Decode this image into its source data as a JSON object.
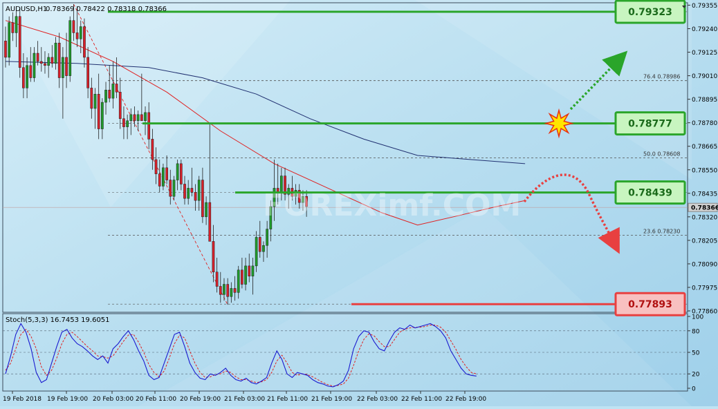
{
  "header": {
    "symbol": "AUDUSD,H1",
    "ohlc": "0.78369 0.78422 0.78318 0.78366",
    "stoch_label": "Stoch(5,3,3) 16.7453 19.6051"
  },
  "watermark": "FOREXimf.COM",
  "colors": {
    "background": "#bfe3f3",
    "bull_candle": "#1f9a2a",
    "bear_candle": "#d8202a",
    "ma_fast": "#e02020",
    "ma_slow": "#203070",
    "support_resistance": "#2aa52a",
    "box_green_fill": "#c8f5c0",
    "box_red_fill": "#f8c0c0",
    "stoch_main": "#1a1ad0",
    "stoch_signal": "#e02020"
  },
  "chart_data": [
    {
      "type": "candlestick",
      "title": "AUDUSD,H1",
      "ylim": [
        0.7786,
        0.7936
      ],
      "y_ticks": [
        "0.79355",
        "0.79240",
        "0.79125",
        "0.79010",
        "0.78895",
        "0.78780",
        "0.78665",
        "0.78550",
        "0.78435",
        "0.78366",
        "0.78320",
        "0.78205",
        "0.78090",
        "0.77975",
        "0.77860"
      ],
      "current_price": "0.78366",
      "x_ticks": [
        "19 Feb 2018",
        "19 Feb 19:00",
        "20 Feb 03:00",
        "20 Feb 11:00",
        "20 Feb 19:00",
        "21 Feb 03:00",
        "21 Feb 11:00",
        "21 Feb 19:00",
        "22 Feb 03:00",
        "22 Feb 11:00",
        "22 Feb 19:00"
      ],
      "price_boxes": [
        {
          "label": "0.79323",
          "value": 0.79323,
          "color": "green"
        },
        {
          "label": "0.78777",
          "value": 0.78777,
          "color": "green"
        },
        {
          "label": "0.78439",
          "value": 0.78439,
          "color": "green"
        },
        {
          "label": "0.77893",
          "value": 0.77893,
          "color": "red"
        }
      ],
      "fibonacci": [
        {
          "label": "76.4",
          "price_label": "0.78986",
          "value": 0.78986
        },
        {
          "label": "50.0",
          "price_label": "0.78608",
          "value": 0.78608
        },
        {
          "label": "23.6",
          "price_label": "0.78230",
          "value": 0.7823
        }
      ],
      "candles": [
        [
          0.7918,
          0.7925,
          0.7905,
          0.791
        ],
        [
          0.791,
          0.793,
          0.7906,
          0.7927
        ],
        [
          0.7927,
          0.7932,
          0.7918,
          0.7922
        ],
        [
          0.7922,
          0.7933,
          0.7915,
          0.793
        ],
        [
          0.793,
          0.7934,
          0.79,
          0.7905
        ],
        [
          0.7905,
          0.7912,
          0.789,
          0.7895
        ],
        [
          0.7895,
          0.791,
          0.789,
          0.7906
        ],
        [
          0.7906,
          0.7915,
          0.7898,
          0.79
        ],
        [
          0.79,
          0.7915,
          0.7898,
          0.7912
        ],
        [
          0.7912,
          0.7918,
          0.7906,
          0.7908
        ],
        [
          0.7908,
          0.7915,
          0.7903,
          0.7907
        ],
        [
          0.7907,
          0.7913,
          0.7902,
          0.7906
        ],
        [
          0.7906,
          0.7912,
          0.79,
          0.791
        ],
        [
          0.791,
          0.7916,
          0.7905,
          0.7907
        ],
        [
          0.7907,
          0.792,
          0.7904,
          0.7917
        ],
        [
          0.7917,
          0.7922,
          0.7895,
          0.79
        ],
        [
          0.79,
          0.7915,
          0.788,
          0.791
        ],
        [
          0.791,
          0.7922,
          0.7895,
          0.7901
        ],
        [
          0.7901,
          0.793,
          0.7898,
          0.7928
        ],
        [
          0.7928,
          0.7936,
          0.7918,
          0.7922
        ],
        [
          0.7922,
          0.7935,
          0.7915,
          0.7919
        ],
        [
          0.7919,
          0.7928,
          0.7912,
          0.7925
        ],
        [
          0.7925,
          0.7929,
          0.7905,
          0.791
        ],
        [
          0.791,
          0.7915,
          0.789,
          0.7895
        ],
        [
          0.7895,
          0.79,
          0.788,
          0.7885
        ],
        [
          0.7885,
          0.7895,
          0.7875,
          0.7892
        ],
        [
          0.7892,
          0.7902,
          0.787,
          0.7875
        ],
        [
          0.7875,
          0.789,
          0.787,
          0.7888
        ],
        [
          0.7888,
          0.7898,
          0.7882,
          0.7894
        ],
        [
          0.7894,
          0.7906,
          0.7888,
          0.789
        ],
        [
          0.789,
          0.7908,
          0.7885,
          0.7897
        ],
        [
          0.7897,
          0.791,
          0.789,
          0.7893
        ],
        [
          0.7893,
          0.79,
          0.7875,
          0.788
        ],
        [
          0.788,
          0.7886,
          0.787,
          0.7876
        ],
        [
          0.7876,
          0.7882,
          0.787,
          0.7879
        ],
        [
          0.7879,
          0.7885,
          0.7872,
          0.7882
        ],
        [
          0.7882,
          0.7886,
          0.7876,
          0.7879
        ],
        [
          0.7879,
          0.7884,
          0.7874,
          0.7882
        ],
        [
          0.7882,
          0.7902,
          0.788,
          0.7879
        ],
        [
          0.7879,
          0.7886,
          0.7872,
          0.7883
        ],
        [
          0.7883,
          0.7888,
          0.7865,
          0.787
        ],
        [
          0.787,
          0.7875,
          0.7855,
          0.786
        ],
        [
          0.786,
          0.7866,
          0.7848,
          0.7853
        ],
        [
          0.7853,
          0.786,
          0.7844,
          0.7847
        ],
        [
          0.7847,
          0.7858,
          0.7845,
          0.7856
        ],
        [
          0.7856,
          0.7862,
          0.7848,
          0.785
        ],
        [
          0.785,
          0.7855,
          0.7838,
          0.7842
        ],
        [
          0.7842,
          0.7852,
          0.784,
          0.785
        ],
        [
          0.785,
          0.786,
          0.7845,
          0.7858
        ],
        [
          0.7858,
          0.786,
          0.7845,
          0.7848
        ],
        [
          0.7848,
          0.7852,
          0.7838,
          0.7841
        ],
        [
          0.7841,
          0.785,
          0.7838,
          0.7846
        ],
        [
          0.7846,
          0.7856,
          0.7842,
          0.7844
        ],
        [
          0.7844,
          0.7848,
          0.7835,
          0.784
        ],
        [
          0.784,
          0.7852,
          0.7835,
          0.785
        ],
        [
          0.785,
          0.7856,
          0.7829,
          0.7832
        ],
        [
          0.7832,
          0.7842,
          0.7828,
          0.7839
        ],
        [
          0.7839,
          0.7878,
          0.7826,
          0.782
        ],
        [
          0.782,
          0.7828,
          0.78,
          0.7805
        ],
        [
          0.7805,
          0.7812,
          0.7795,
          0.7798
        ],
        [
          0.7798,
          0.7805,
          0.779,
          0.7794
        ],
        [
          0.7794,
          0.7802,
          0.7791,
          0.7799
        ],
        [
          0.7799,
          0.7802,
          0.7789,
          0.7793
        ],
        [
          0.7793,
          0.78,
          0.779,
          0.7797
        ],
        [
          0.7797,
          0.7803,
          0.7791,
          0.7795
        ],
        [
          0.7795,
          0.7808,
          0.7792,
          0.7806
        ],
        [
          0.7806,
          0.7812,
          0.7797,
          0.7799
        ],
        [
          0.7799,
          0.7812,
          0.7796,
          0.7808
        ],
        [
          0.7808,
          0.7814,
          0.78,
          0.7803
        ],
        [
          0.7803,
          0.7812,
          0.7794,
          0.7808
        ],
        [
          0.7808,
          0.7825,
          0.7805,
          0.7822
        ],
        [
          0.7822,
          0.783,
          0.7812,
          0.7815
        ],
        [
          0.7815,
          0.782,
          0.781,
          0.7818
        ],
        [
          0.7818,
          0.783,
          0.7812,
          0.7826
        ],
        [
          0.7826,
          0.784,
          0.782,
          0.7837
        ],
        [
          0.7837,
          0.786,
          0.783,
          0.7846
        ],
        [
          0.7846,
          0.7858,
          0.7838,
          0.7844
        ],
        [
          0.7844,
          0.7856,
          0.784,
          0.7852
        ],
        [
          0.7852,
          0.7856,
          0.784,
          0.7843
        ],
        [
          0.7843,
          0.7848,
          0.7836,
          0.7846
        ],
        [
          0.7846,
          0.7852,
          0.784,
          0.7842
        ],
        [
          0.7842,
          0.7848,
          0.7838,
          0.7845
        ],
        [
          0.7845,
          0.7848,
          0.7836,
          0.7839
        ],
        [
          0.7839,
          0.7845,
          0.7835,
          0.7842
        ],
        [
          0.7842,
          0.7845,
          0.7832,
          0.7837
        ]
      ],
      "ma_fast": [
        [
          0,
          0.7928
        ],
        [
          15,
          0.792
        ],
        [
          30,
          0.7908
        ],
        [
          45,
          0.7893
        ],
        [
          60,
          0.7874
        ],
        [
          75,
          0.7858
        ],
        [
          90,
          0.7846
        ],
        [
          105,
          0.7834
        ],
        [
          115,
          0.7828
        ],
        [
          125,
          0.7832
        ],
        [
          137,
          0.7837
        ],
        [
          145,
          0.784
        ]
      ],
      "ma_slow": [
        [
          0,
          0.7908
        ],
        [
          20,
          0.7907
        ],
        [
          40,
          0.7905
        ],
        [
          55,
          0.79
        ],
        [
          70,
          0.7892
        ],
        [
          85,
          0.788
        ],
        [
          100,
          0.787
        ],
        [
          115,
          0.7862
        ],
        [
          130,
          0.786
        ],
        [
          145,
          0.7858
        ]
      ]
    },
    {
      "type": "line",
      "title": "Stoch(5,3,3) 16.7453 19.6051",
      "ylim": [
        0,
        100
      ],
      "y_ticks": [
        "100",
        "80",
        "50",
        "20",
        "0"
      ],
      "series": [
        {
          "values": [
            20,
            45,
            75,
            90,
            78,
            55,
            22,
            8,
            12,
            35,
            58,
            78,
            82,
            70,
            62,
            58,
            52,
            45,
            40,
            45,
            35,
            55,
            62,
            72,
            80,
            68,
            52,
            38,
            18,
            12,
            15,
            35,
            55,
            75,
            78,
            58,
            35,
            22,
            14,
            12,
            20,
            18,
            22,
            28,
            18,
            12,
            10,
            14,
            8,
            6,
            10,
            15,
            35,
            52,
            40,
            20,
            15,
            22,
            20,
            18,
            12,
            8,
            6,
            3,
            2,
            5,
            10,
            25,
            55,
            72,
            80,
            78,
            65,
            55,
            52,
            66,
            78,
            84,
            82,
            88,
            84,
            86,
            88,
            90,
            86,
            80,
            70,
            52,
            40,
            28,
            20,
            18,
            17
          ]
        },
        {
          "values": [
            25,
            35,
            55,
            75,
            82,
            72,
            55,
            30,
            18,
            25,
            42,
            62,
            75,
            78,
            72,
            65,
            58,
            52,
            45,
            44,
            42,
            45,
            55,
            65,
            74,
            75,
            64,
            50,
            33,
            22,
            16,
            24,
            42,
            62,
            74,
            70,
            52,
            35,
            22,
            15,
            16,
            19,
            20,
            24,
            22,
            16,
            12,
            12,
            10,
            8,
            9,
            12,
            22,
            38,
            46,
            35,
            22,
            18,
            20,
            19,
            16,
            12,
            8,
            5,
            3,
            4,
            6,
            14,
            32,
            52,
            68,
            76,
            73,
            65,
            58,
            58,
            68,
            78,
            82,
            84,
            85,
            85,
            86,
            88,
            88,
            85,
            78,
            66,
            54,
            40,
            30,
            22,
            20
          ]
        }
      ]
    }
  ]
}
